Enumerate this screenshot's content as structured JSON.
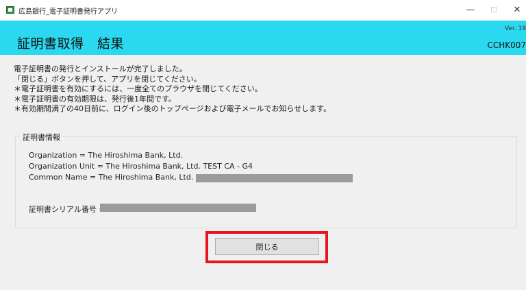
{
  "window": {
    "title": "広島銀行_電子証明書発行アプリ",
    "minimize_glyph": "—",
    "maximize_glyph": "☐",
    "close_glyph": "✕",
    "app_icon": "certificate-app-icon"
  },
  "header": {
    "title": "証明書取得　結果",
    "version": "Ver. 19",
    "screen_id": "CCHK007"
  },
  "messages": [
    "電子証明書の発行とインストールが完了しました。",
    "「閉じる」ボタンを押して、アプリを閉じてください。",
    "＊電子証明書を有効にするには、一度全てのブラウザを閉じてください。",
    "＊電子証明書の有効期限は、発行後1年間です。",
    "＊有効期間満了の40日前に、ログイン後のトップページおよび電子メールでお知らせします。"
  ],
  "cert_info": {
    "caption": "証明書情報",
    "organization": "Organization = The Hiroshima Bank, Ltd.",
    "organization_unit": "Organization Unit = The Hiroshima Bank, Ltd. TEST CA - G4",
    "common_name": "Common Name = The Hiroshima Bank, Ltd.",
    "serial_label": "証明書シリアル番号 ="
  },
  "buttons": {
    "close_label": "閉じる"
  },
  "colors": {
    "header_bg": "#2ad9f0",
    "highlight": "#e8141e",
    "redaction": "#9b9b9b"
  }
}
